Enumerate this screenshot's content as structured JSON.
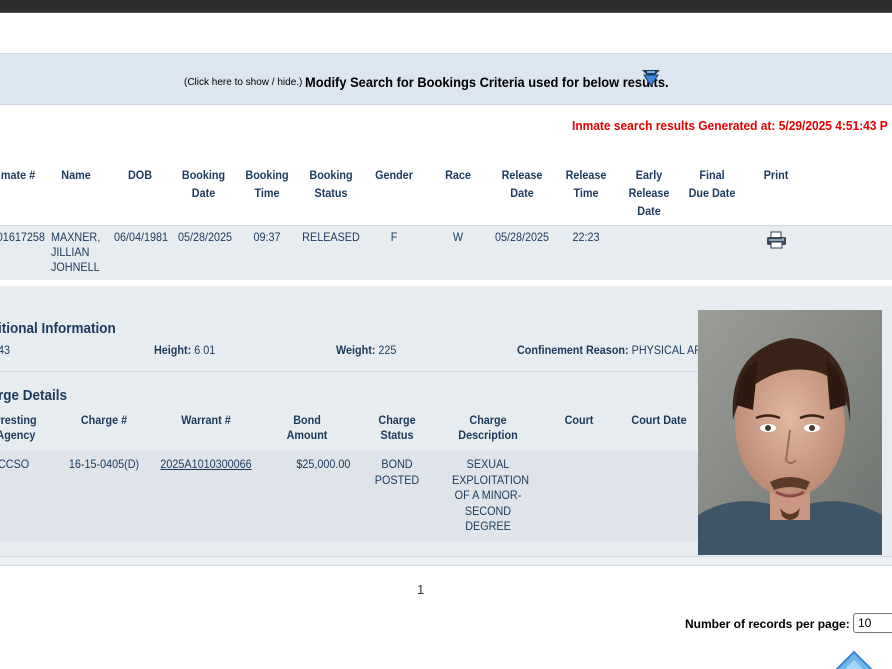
{
  "search_toggle": {
    "hint": "(Click here to show / hide.)",
    "title": "Modify Search for Bookings Criteria used for below results.",
    "icon": "double-chevron-down-icon"
  },
  "generated_text": "Inmate search results Generated at: 5/29/2025 4:51:43 P",
  "results_table": {
    "columns": [
      "mate #",
      "Name",
      "DOB",
      "Booking Date",
      "Booking Time",
      "Booking Status",
      "Gender",
      "Race",
      "Release Date",
      "Release Time",
      "Early Release Date",
      "Final Due Date",
      "Print"
    ],
    "row": {
      "inmate_number": "01617258",
      "name": "MAXNER, JILLIAN JOHNELL",
      "dob": "06/04/1981",
      "booking_date": "05/28/2025",
      "booking_time": "09:37",
      "booking_status": "RELEASED",
      "gender": "F",
      "race": "W",
      "release_date": "05/28/2025",
      "release_time": "22:23",
      "early_release_date": "",
      "final_due_date": "",
      "print_icon": "printer-icon"
    }
  },
  "additional_info": {
    "title": "itional Information",
    "age_value": "43",
    "height_label": "Height:",
    "height_value": "6 01",
    "weight_label": "Weight:",
    "weight_value": "225",
    "confinement_label": "Confinement Reason:",
    "confinement_value": "PHYSICAL ARR"
  },
  "charge_details": {
    "title": "rge Details",
    "columns": [
      "rresting Agency",
      "Charge #",
      "Warrant #",
      "Bond Amount",
      "Charge Status",
      "Charge Description",
      "Court",
      "Court Date"
    ],
    "row": {
      "agency": "CCSO",
      "charge_number": "16-15-0405(D)",
      "warrant_number": "2025A1010300066",
      "bond_amount": "$25,000.00",
      "charge_status": "BOND POSTED",
      "description": "SEXUAL EXPLOITATION OF A MINOR- SECOND DEGREE",
      "court": "",
      "court_date": ""
    }
  },
  "pagination": {
    "current_page": "1"
  },
  "records_per_page": {
    "label": "Number of records per page:",
    "selected": "10"
  },
  "colors": {
    "header_text": "#1b3a5c",
    "generated_text": "#e60000",
    "row_background": "#e7ecf1",
    "search_bar": "#dce6f0"
  }
}
